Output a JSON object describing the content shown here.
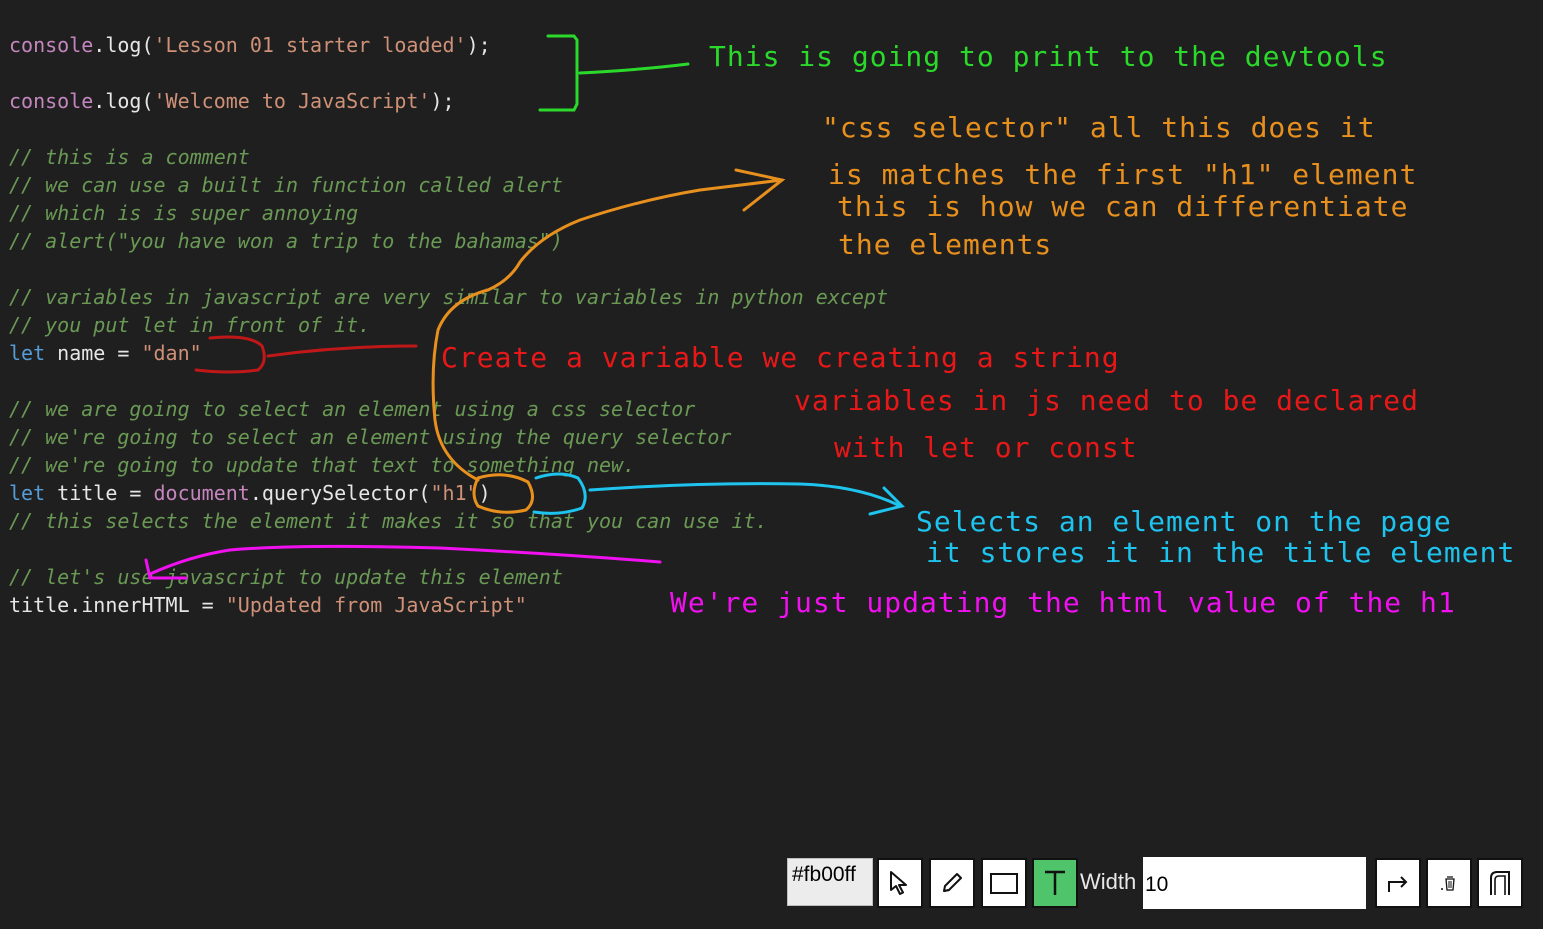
{
  "code": {
    "line1": {
      "obj": "console",
      "dot": ".",
      "fn": "log",
      "open": "(",
      "str": "'Lesson 01 starter loaded'",
      "close": ");"
    },
    "line2": {
      "obj": "console",
      "dot": ".",
      "fn": "log",
      "open": "(",
      "str": "'Welcome to JavaScript'",
      "close": ");"
    },
    "comments_a": [
      "// this is a comment",
      "// we can use a built in function called alert",
      "// which is is super annoying",
      "// alert(\"you have won a trip to the bahamas\")"
    ],
    "comments_b": [
      "// variables in javascript are very similar to variables in python except",
      "// you put let in front of it."
    ],
    "let_name": {
      "kw": "let",
      "rest": " name = ",
      "str": "\"dan\""
    },
    "comments_c": [
      "// we are going to select an element using a css selector",
      "// we're going to select an element using the query selector",
      "// we're going to update that text to something new."
    ],
    "let_title": {
      "kw": "let",
      "rest": " title = ",
      "obj": "document",
      "dot": ".",
      "fn": "querySelector",
      "open": "(",
      "str": "\"h1\"",
      "close": ")"
    },
    "comment_d": "// this selects the element it makes it so that you can use it.",
    "comment_e": "// let's use javascript to update this element",
    "title_update": {
      "plain": "title.innerHTML = ",
      "str": "\"Updated from JavaScript\""
    }
  },
  "annotations": {
    "green": "This is going to print to the devtools",
    "orange": [
      "\"css selector\" all this does it",
      "is matches the first \"h1\" element",
      "this is how we can differentiate",
      "the elements"
    ],
    "red": [
      "Create a variable we creating a string",
      "variables in js need to be declared",
      "with let or const"
    ],
    "blue": [
      "Selects an element on the page",
      "it stores it in the title element"
    ],
    "magenta": "We're just updating the html value of the h1"
  },
  "colors": {
    "green": "#2bd92b",
    "orange": "#e8901e",
    "red": "#e81818",
    "blue": "#1ec3ee",
    "magenta": "#f010f0",
    "background": "#1f1f1f"
  },
  "toolbar": {
    "color_value": "#fb00ff",
    "width_label": "Width",
    "width_value": "10",
    "tools": [
      "pointer-icon",
      "pencil-icon",
      "rectangle-icon",
      "text-icon",
      "redo-icon",
      "trash-icon",
      "clear-icon"
    ]
  }
}
